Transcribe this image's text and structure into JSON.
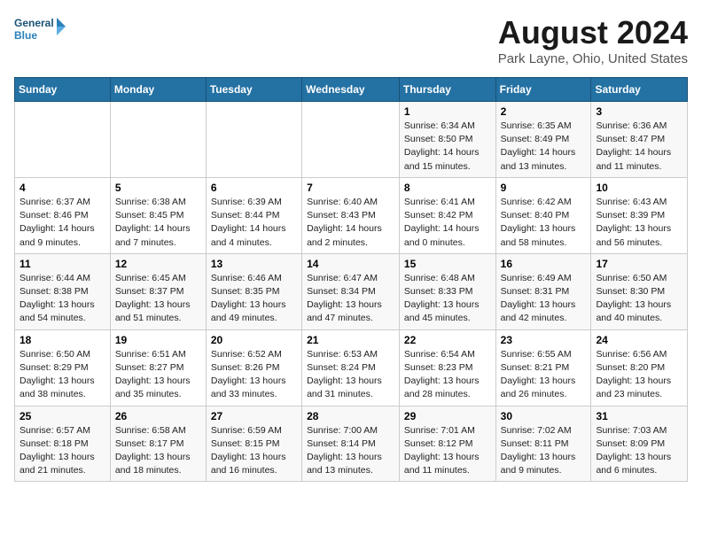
{
  "header": {
    "logo_line1": "General",
    "logo_line2": "Blue",
    "month_year": "August 2024",
    "location": "Park Layne, Ohio, United States"
  },
  "weekdays": [
    "Sunday",
    "Monday",
    "Tuesday",
    "Wednesday",
    "Thursday",
    "Friday",
    "Saturday"
  ],
  "weeks": [
    [
      {
        "day": "",
        "info": ""
      },
      {
        "day": "",
        "info": ""
      },
      {
        "day": "",
        "info": ""
      },
      {
        "day": "",
        "info": ""
      },
      {
        "day": "1",
        "info": "Sunrise: 6:34 AM\nSunset: 8:50 PM\nDaylight: 14 hours\nand 15 minutes."
      },
      {
        "day": "2",
        "info": "Sunrise: 6:35 AM\nSunset: 8:49 PM\nDaylight: 14 hours\nand 13 minutes."
      },
      {
        "day": "3",
        "info": "Sunrise: 6:36 AM\nSunset: 8:47 PM\nDaylight: 14 hours\nand 11 minutes."
      }
    ],
    [
      {
        "day": "4",
        "info": "Sunrise: 6:37 AM\nSunset: 8:46 PM\nDaylight: 14 hours\nand 9 minutes."
      },
      {
        "day": "5",
        "info": "Sunrise: 6:38 AM\nSunset: 8:45 PM\nDaylight: 14 hours\nand 7 minutes."
      },
      {
        "day": "6",
        "info": "Sunrise: 6:39 AM\nSunset: 8:44 PM\nDaylight: 14 hours\nand 4 minutes."
      },
      {
        "day": "7",
        "info": "Sunrise: 6:40 AM\nSunset: 8:43 PM\nDaylight: 14 hours\nand 2 minutes."
      },
      {
        "day": "8",
        "info": "Sunrise: 6:41 AM\nSunset: 8:42 PM\nDaylight: 14 hours\nand 0 minutes."
      },
      {
        "day": "9",
        "info": "Sunrise: 6:42 AM\nSunset: 8:40 PM\nDaylight: 13 hours\nand 58 minutes."
      },
      {
        "day": "10",
        "info": "Sunrise: 6:43 AM\nSunset: 8:39 PM\nDaylight: 13 hours\nand 56 minutes."
      }
    ],
    [
      {
        "day": "11",
        "info": "Sunrise: 6:44 AM\nSunset: 8:38 PM\nDaylight: 13 hours\nand 54 minutes."
      },
      {
        "day": "12",
        "info": "Sunrise: 6:45 AM\nSunset: 8:37 PM\nDaylight: 13 hours\nand 51 minutes."
      },
      {
        "day": "13",
        "info": "Sunrise: 6:46 AM\nSunset: 8:35 PM\nDaylight: 13 hours\nand 49 minutes."
      },
      {
        "day": "14",
        "info": "Sunrise: 6:47 AM\nSunset: 8:34 PM\nDaylight: 13 hours\nand 47 minutes."
      },
      {
        "day": "15",
        "info": "Sunrise: 6:48 AM\nSunset: 8:33 PM\nDaylight: 13 hours\nand 45 minutes."
      },
      {
        "day": "16",
        "info": "Sunrise: 6:49 AM\nSunset: 8:31 PM\nDaylight: 13 hours\nand 42 minutes."
      },
      {
        "day": "17",
        "info": "Sunrise: 6:50 AM\nSunset: 8:30 PM\nDaylight: 13 hours\nand 40 minutes."
      }
    ],
    [
      {
        "day": "18",
        "info": "Sunrise: 6:50 AM\nSunset: 8:29 PM\nDaylight: 13 hours\nand 38 minutes."
      },
      {
        "day": "19",
        "info": "Sunrise: 6:51 AM\nSunset: 8:27 PM\nDaylight: 13 hours\nand 35 minutes."
      },
      {
        "day": "20",
        "info": "Sunrise: 6:52 AM\nSunset: 8:26 PM\nDaylight: 13 hours\nand 33 minutes."
      },
      {
        "day": "21",
        "info": "Sunrise: 6:53 AM\nSunset: 8:24 PM\nDaylight: 13 hours\nand 31 minutes."
      },
      {
        "day": "22",
        "info": "Sunrise: 6:54 AM\nSunset: 8:23 PM\nDaylight: 13 hours\nand 28 minutes."
      },
      {
        "day": "23",
        "info": "Sunrise: 6:55 AM\nSunset: 8:21 PM\nDaylight: 13 hours\nand 26 minutes."
      },
      {
        "day": "24",
        "info": "Sunrise: 6:56 AM\nSunset: 8:20 PM\nDaylight: 13 hours\nand 23 minutes."
      }
    ],
    [
      {
        "day": "25",
        "info": "Sunrise: 6:57 AM\nSunset: 8:18 PM\nDaylight: 13 hours\nand 21 minutes."
      },
      {
        "day": "26",
        "info": "Sunrise: 6:58 AM\nSunset: 8:17 PM\nDaylight: 13 hours\nand 18 minutes."
      },
      {
        "day": "27",
        "info": "Sunrise: 6:59 AM\nSunset: 8:15 PM\nDaylight: 13 hours\nand 16 minutes."
      },
      {
        "day": "28",
        "info": "Sunrise: 7:00 AM\nSunset: 8:14 PM\nDaylight: 13 hours\nand 13 minutes."
      },
      {
        "day": "29",
        "info": "Sunrise: 7:01 AM\nSunset: 8:12 PM\nDaylight: 13 hours\nand 11 minutes."
      },
      {
        "day": "30",
        "info": "Sunrise: 7:02 AM\nSunset: 8:11 PM\nDaylight: 13 hours\nand 9 minutes."
      },
      {
        "day": "31",
        "info": "Sunrise: 7:03 AM\nSunset: 8:09 PM\nDaylight: 13 hours\nand 6 minutes."
      }
    ]
  ]
}
